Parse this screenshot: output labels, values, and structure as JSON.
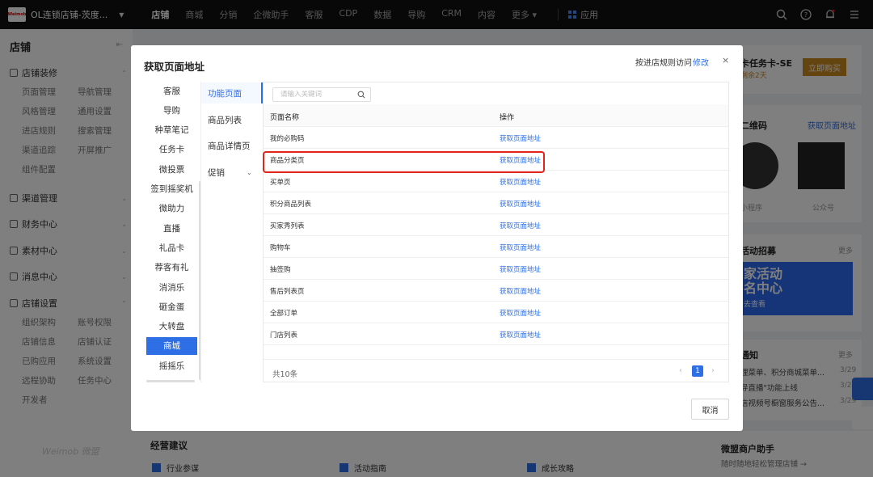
{
  "topbar": {
    "logo_text": "Weimob",
    "store_name": "OL连锁店铺-茨度...",
    "nav": [
      "店铺",
      "商城",
      "分销",
      "企微助手",
      "客服",
      "CDP",
      "数据",
      "导购",
      "CRM",
      "内容",
      "更多 ▾"
    ],
    "active_nav_index": 0,
    "app_label": "应用"
  },
  "sidebar": {
    "title": "店铺",
    "groups": [
      {
        "label": "店铺装修",
        "subs": [
          "页面管理",
          "导航管理",
          "风格管理",
          "通用设置",
          "进店规则",
          "搜索管理",
          "渠道追踪",
          "开屏推广",
          "组件配置"
        ]
      },
      {
        "label": "渠道管理",
        "subs": []
      },
      {
        "label": "财务中心",
        "subs": []
      },
      {
        "label": "素材中心",
        "subs": []
      },
      {
        "label": "消息中心",
        "subs": []
      },
      {
        "label": "店铺设置",
        "subs": [
          "组织架构",
          "账号权限",
          "店铺信息",
          "店铺认证",
          "已购应用",
          "系统设置",
          "远程协助",
          "任务中心",
          "开发者"
        ]
      }
    ],
    "brand_footer": "Weimob 微盟"
  },
  "right_panel": {
    "task_card_title": "卡任务卡-SE",
    "task_card_sub": "剩余2天",
    "buy_button": "立即购买",
    "qr_title": "二维码",
    "qr_link": "获取页面地址",
    "qr_labels": [
      "小程序",
      "公众号"
    ],
    "campaign_title": "活动招募",
    "campaign_more": "更多",
    "banner_line1": "家活动",
    "banner_line2": "名中心",
    "banner_cta": "去查看",
    "notice_title": "通知",
    "notice_more": "更多",
    "notices": [
      {
        "text": "理菜单、积分商城菜单...",
        "date": "3/29"
      },
      {
        "text": "导直播\"功能上线",
        "date": "3/29"
      },
      {
        "text": "信视频号橱窗服务公告...",
        "date": "3/29"
      }
    ]
  },
  "bottom_strip": {
    "title": "经营建议",
    "items": [
      "行业参谋",
      "活动指南",
      "成长攻略"
    ],
    "assistant_title": "微盟商户助手",
    "assistant_sub": "随时随地轻松管理店铺 →"
  },
  "dialog": {
    "title": "获取页面地址",
    "hint": "按进店规则访问",
    "edit_link": "修改",
    "close": "×",
    "categories": [
      "客服",
      "导购",
      "种草笔记",
      "任务卡",
      "微投票",
      "签到摇奖机",
      "微助力",
      "直播",
      "礼品卡",
      "荐客有礼",
      "消消乐",
      "砸金蛋",
      "大转盘",
      "商城",
      "摇摇乐"
    ],
    "active_category_index": 13,
    "subcategories": [
      "功能页面",
      "商品列表",
      "商品详情页",
      "促销"
    ],
    "active_subcategory_index": 0,
    "search": {
      "placeholder": "请输入关键词",
      "value": ""
    },
    "table": {
      "headers": [
        "页面名称",
        "操作"
      ],
      "rows": [
        {
          "name": "我的必购码",
          "action": "获取页面地址"
        },
        {
          "name": "商品分类页",
          "action": "获取页面地址"
        },
        {
          "name": "买单页",
          "action": "获取页面地址"
        },
        {
          "name": "积分商品列表",
          "action": "获取页面地址"
        },
        {
          "name": "买家秀列表",
          "action": "获取页面地址"
        },
        {
          "name": "购物车",
          "action": "获取页面地址"
        },
        {
          "name": "抽签购",
          "action": "获取页面地址"
        },
        {
          "name": "售后列表页",
          "action": "获取页面地址"
        },
        {
          "name": "全部订单",
          "action": "获取页面地址"
        },
        {
          "name": "门店列表",
          "action": "获取页面地址"
        }
      ],
      "highlighted_row_index": 1
    },
    "total": "共10条",
    "current_page": "1",
    "cancel": "取消"
  },
  "colors": {
    "accent": "#2f6fe6",
    "highlight": "#e1251b",
    "topbar": "#111111"
  }
}
